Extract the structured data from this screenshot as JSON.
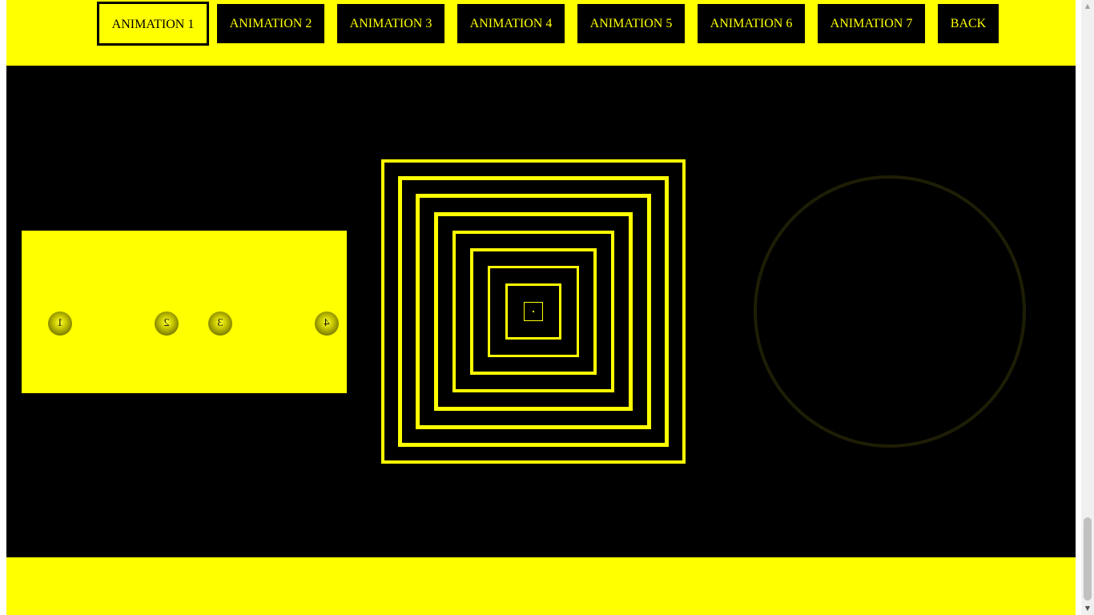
{
  "nav": {
    "buttons": [
      {
        "label": "ANIMATION 1",
        "active": true
      },
      {
        "label": "ANIMATION 2",
        "active": false
      },
      {
        "label": "ANIMATION 3",
        "active": false
      },
      {
        "label": "ANIMATION 4",
        "active": false
      },
      {
        "label": "ANIMATION 5",
        "active": false
      },
      {
        "label": "ANIMATION 6",
        "active": false
      },
      {
        "label": "ANIMATION 7",
        "active": false
      },
      {
        "label": "BACK",
        "active": false
      }
    ]
  },
  "balls": {
    "labels": [
      "1",
      "2",
      "3",
      "4"
    ]
  },
  "squares": {
    "count": 9
  },
  "scrollbar": {
    "up_icon": "▲",
    "down_icon": "▼"
  },
  "colors": {
    "accent": "#ffff00",
    "background": "#000000",
    "ring": "#1e1e06"
  }
}
